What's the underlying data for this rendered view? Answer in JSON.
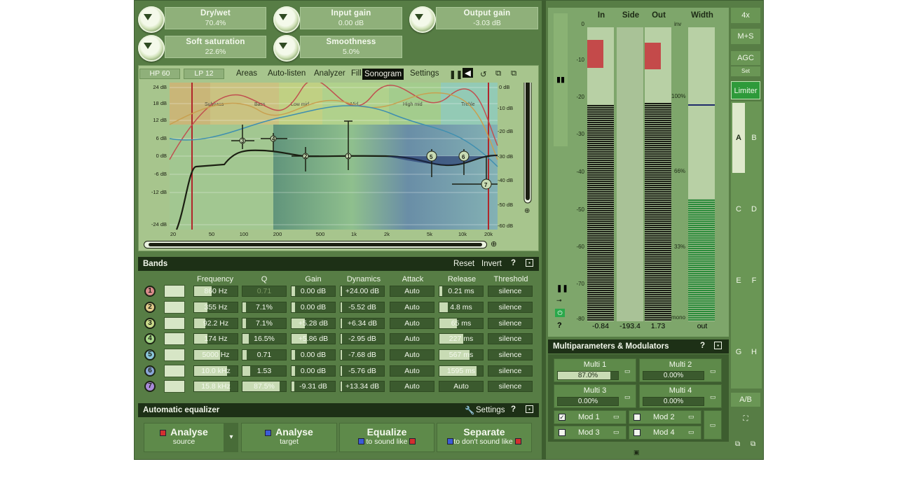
{
  "knobs": [
    {
      "label": "Dry/wet",
      "value": "70.4%"
    },
    {
      "label": "Input gain",
      "value": "0.00 dB"
    },
    {
      "label": "Output gain",
      "value": "-3.03 dB"
    },
    {
      "label": "Soft saturation",
      "value": "22.6%"
    },
    {
      "label": "Smoothness",
      "value": "5.0%"
    }
  ],
  "toolbar": {
    "hp": "HP 60",
    "lp": "LP 12",
    "areas": "Areas",
    "autolisten": "Auto-listen",
    "analyzer": "Analyzer",
    "fill": "Fill",
    "sonogram": "Sonogram",
    "settings": "Settings"
  },
  "graph": {
    "db_left": [
      "24 dB",
      "18 dB",
      "12 dB",
      "6 dB",
      "0 dB",
      "-6 dB",
      "-12 dB",
      "-24 dB"
    ],
    "db_right": [
      "0 dB",
      "-10 dB",
      "-20 dB",
      "-30 dB",
      "-40 dB",
      "-50 dB",
      "-60 dB"
    ],
    "freq": [
      "20",
      "50",
      "100",
      "200",
      "500",
      "1k",
      "2k",
      "5k",
      "10k",
      "20k"
    ],
    "areas": [
      "Subbass",
      "Bass",
      "Low mid",
      "Mid",
      "High mid",
      "Treble"
    ]
  },
  "bands": {
    "title": "Bands",
    "reset": "Reset",
    "invert": "Invert",
    "help": "?",
    "columns": [
      "Frequency",
      "Q",
      "Gain",
      "Dynamics",
      "Attack",
      "Release",
      "Threshold"
    ],
    "rows": [
      {
        "n": "1",
        "freq": "860 Hz",
        "q": "0.71",
        "gain": "0.00 dB",
        "dyn": "+24.00 dB",
        "attack": "Auto",
        "release": "0.21 ms",
        "thr": "silence",
        "color": "#d98b8b"
      },
      {
        "n": "2",
        "freq": "355 Hz",
        "q": "7.1%",
        "gain": "0.00 dB",
        "dyn": "-5.52 dB",
        "attack": "Auto",
        "release": "4.8 ms",
        "thr": "silence",
        "color": "#e0c98a"
      },
      {
        "n": "3",
        "freq": "92.2 Hz",
        "q": "7.1%",
        "gain": "+5.28 dB",
        "dyn": "+6.34 dB",
        "attack": "Auto",
        "release": "65 ms",
        "thr": "silence",
        "color": "#c9d98a"
      },
      {
        "n": "4",
        "freq": "174 Hz",
        "q": "16.5%",
        "gain": "+5.86 dB",
        "dyn": "-2.95 dB",
        "attack": "Auto",
        "release": "227 ms",
        "thr": "silence",
        "color": "#a8d98a"
      },
      {
        "n": "5",
        "freq": "5000 Hz",
        "q": "0.71",
        "gain": "0.00 dB",
        "dyn": "-7.68 dB",
        "attack": "Auto",
        "release": "567 ms",
        "thr": "silence",
        "color": "#8ac4d9"
      },
      {
        "n": "6",
        "freq": "10.0 kHz",
        "q": "1.53",
        "gain": "0.00 dB",
        "dyn": "-5.76 dB",
        "attack": "Auto",
        "release": "1595 ms",
        "thr": "silence",
        "color": "#8aa6d9"
      },
      {
        "n": "7",
        "freq": "15.8 kHz",
        "q": "87.5%",
        "gain": "-9.31 dB",
        "dyn": "+13.34 dB",
        "attack": "Auto",
        "release": "Auto",
        "thr": "silence",
        "color": "#a98ad9"
      }
    ]
  },
  "autoeq": {
    "title": "Automatic equalizer",
    "settings": "Settings",
    "help": "?",
    "buttons": [
      {
        "t1": "Analyse",
        "t2": "source"
      },
      {
        "t1": "Analyse",
        "t2": "target"
      },
      {
        "t1": "Equalize",
        "t2": "to sound like"
      },
      {
        "t1": "Separate",
        "t2": "to don't sound like"
      }
    ]
  },
  "meters": {
    "labels": {
      "in": "In",
      "side": "Side",
      "out": "Out",
      "width": "Width"
    },
    "scale": [
      "0",
      "-10",
      "-20",
      "-30",
      "-40",
      "-50",
      "-60",
      "-70",
      "-80"
    ],
    "width_scale": [
      "inv",
      "100%",
      "66%",
      "33%",
      "mono"
    ],
    "readouts": {
      "in": "-0.84",
      "side": "-193.4",
      "out": "1.73",
      "width": "out"
    },
    "help": "?"
  },
  "abpanel": {
    "x4": "4x",
    "ms": "M+S",
    "agc": "AGC",
    "set": "Set",
    "limiter": "Limiter",
    "a": "A",
    "b": "B",
    "c": "C",
    "d": "D",
    "e": "E",
    "f": "F",
    "g": "G",
    "h": "H",
    "ab": "A/B"
  },
  "multi": {
    "title": "Multiparameters & Modulators",
    "help": "?",
    "params": [
      {
        "name": "Multi 1",
        "value": "87.0%"
      },
      {
        "name": "Multi 2",
        "value": "0.00%"
      },
      {
        "name": "Multi 3",
        "value": "0.00%"
      },
      {
        "name": "Multi 4",
        "value": "0.00%"
      }
    ],
    "mods": [
      {
        "name": "Mod 1",
        "checked": true
      },
      {
        "name": "Mod 2",
        "checked": false
      },
      {
        "name": "Mod 3",
        "checked": false
      },
      {
        "name": "Mod 4",
        "checked": false
      }
    ]
  },
  "colors": {
    "bg": "#577d45",
    "panel": "#1d3016",
    "accent_red": "#d32f2f",
    "accent_blue": "#3b5bd6"
  }
}
